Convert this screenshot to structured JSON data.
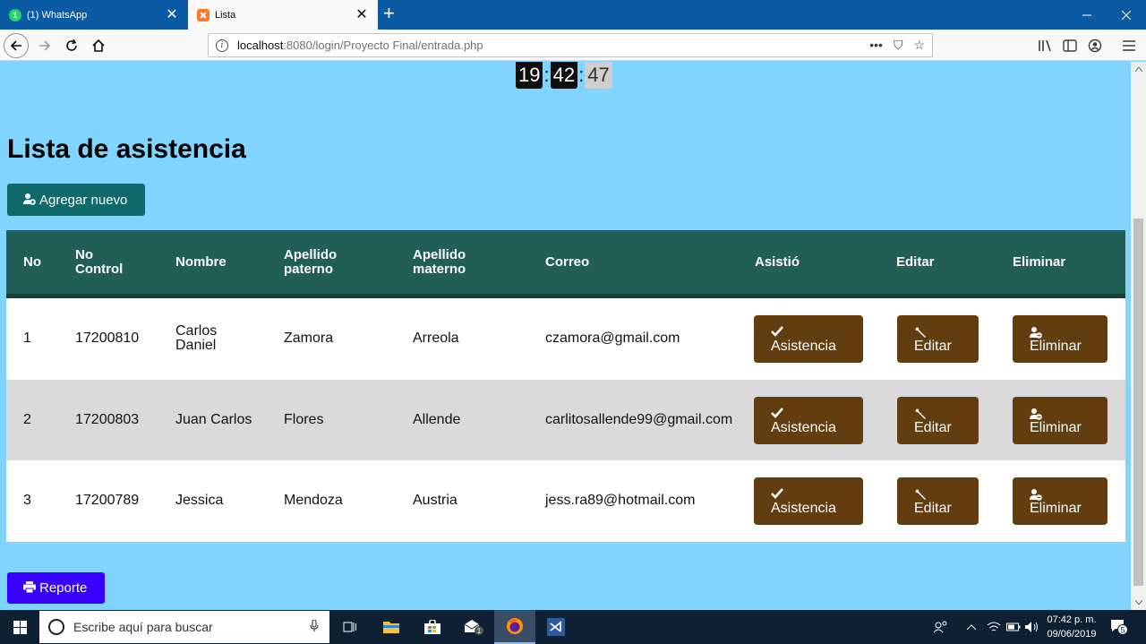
{
  "browser": {
    "tabs": [
      {
        "label": "(1) WhatsApp",
        "favicon": "1",
        "active": false
      },
      {
        "label": "Lista",
        "active": true
      }
    ],
    "close_glyph": "✕",
    "new_tab_glyph": "+",
    "url_host": "localhost",
    "url_rest": ":8080/login/Proyecto Final/entrada.php",
    "url_actions": [
      "•••",
      "⛉",
      "☆"
    ]
  },
  "clock": {
    "hours": "19",
    "minutes": "42",
    "seconds": "47",
    "separator": ":"
  },
  "page": {
    "title": "Lista de asistencia",
    "add_button": "Agregar nuevo",
    "report_button": "Reporte"
  },
  "table": {
    "headers": {
      "no": "No",
      "control_1": "No",
      "control_2": "Control",
      "nombre": "Nombre",
      "paterno_1": "Apellido",
      "paterno_2": "paterno",
      "materno_1": "Apellido",
      "materno_2": "materno",
      "correo": "Correo",
      "asistio": "Asistió",
      "editar": "Editar",
      "eliminar": "Eliminar"
    },
    "rows": [
      {
        "no": "1",
        "control": "17200810",
        "nombre_1": "Carlos",
        "nombre_2": "Daniel",
        "paterno": "Zamora",
        "materno": "Arreola",
        "correo": "czamora@gmail.com"
      },
      {
        "no": "2",
        "control": "17200803",
        "nombre_1": "Juan Carlos",
        "nombre_2": "",
        "paterno": "Flores",
        "materno": "Allende",
        "correo": "carlitosallende99@gmail.com"
      },
      {
        "no": "3",
        "control": "17200789",
        "nombre_1": "Jessica",
        "nombre_2": "",
        "paterno": "Mendoza",
        "materno": "Austria",
        "correo": "jess.ra89@hotmail.com"
      }
    ],
    "row_buttons": {
      "asistencia": "Asistencia",
      "editar": "Editar",
      "eliminar": "Eliminar"
    }
  },
  "taskbar": {
    "search_placeholder": "Escribe aquí para buscar",
    "time": "07:42 p. m.",
    "date": "09/06/2019",
    "notification_count": "5",
    "mail_badge": "1"
  },
  "colors": {
    "page_bg": "#81d4fd",
    "header_green": "#215e56",
    "add_button": "#106a6a",
    "action_brown": "#623d10",
    "report_blue": "#3700ff",
    "stripe_gray": "#dadada"
  },
  "icons": {
    "add": "user-plus-icon",
    "check": "check-icon",
    "wrench": "wrench-icon",
    "user_minus": "user-minus-icon",
    "print": "printer-icon"
  }
}
